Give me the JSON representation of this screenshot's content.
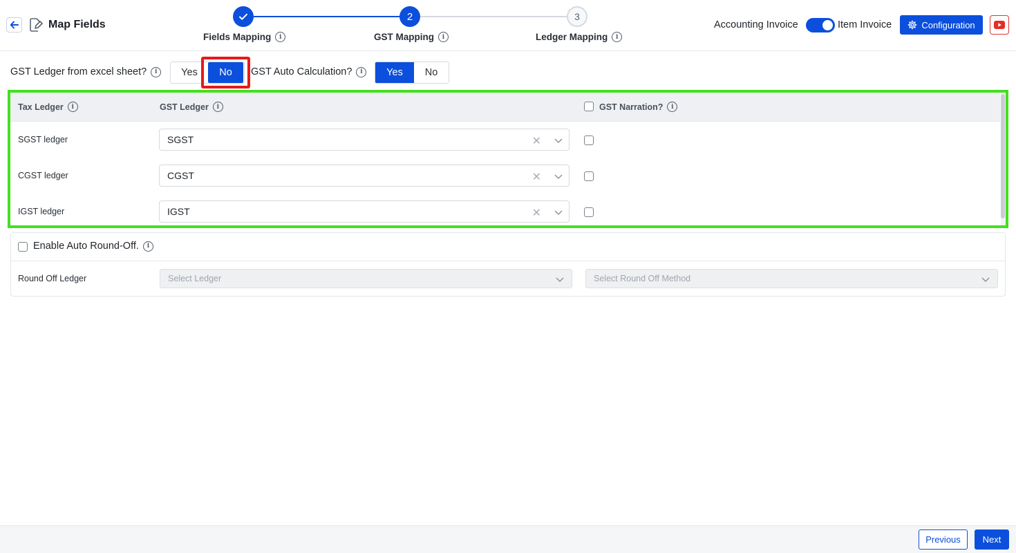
{
  "header": {
    "title": "Map Fields",
    "steps": [
      {
        "label": "Fields Mapping",
        "state": "done",
        "number": ""
      },
      {
        "label": "GST Mapping",
        "state": "active",
        "number": "2"
      },
      {
        "label": "Ledger Mapping",
        "state": "pending",
        "number": "3"
      }
    ],
    "invoice_toggle": {
      "left_label": "Accounting Invoice",
      "right_label": "Item Invoice",
      "on": true
    },
    "config_button": "Configuration"
  },
  "options": {
    "gst_from_excel": {
      "label": "GST Ledger from excel sheet?",
      "yes": "Yes",
      "no": "No",
      "selected": "No"
    },
    "gst_auto_calc": {
      "label": "GST Auto Calculation?",
      "yes": "Yes",
      "no": "No",
      "selected": "Yes"
    }
  },
  "table": {
    "headers": {
      "tax_ledger": "Tax Ledger",
      "gst_ledger": "GST Ledger",
      "gst_narration": "GST Narration?"
    },
    "rows": [
      {
        "label": "SGST ledger",
        "value": "SGST",
        "narration": false
      },
      {
        "label": "CGST ledger",
        "value": "CGST",
        "narration": false
      },
      {
        "label": "IGST ledger",
        "value": "IGST",
        "narration": false
      }
    ]
  },
  "round_off": {
    "enable_label": "Enable Auto Round-Off.",
    "enabled": false,
    "ledger_label": "Round Off Ledger",
    "ledger_placeholder": "Select Ledger",
    "method_placeholder": "Select Round Off Method"
  },
  "footer": {
    "previous": "Previous",
    "next": "Next"
  },
  "colors": {
    "primary": "#0b4fdc",
    "highlight_red": "#e8191a",
    "highlight_green": "#44e01f"
  }
}
